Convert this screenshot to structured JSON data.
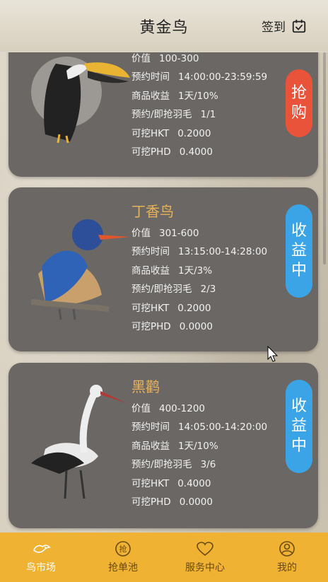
{
  "header": {
    "title": "黄金鸟",
    "checkin_label": "签到",
    "checkin_icon": "calendar-check-icon"
  },
  "cards": [
    {
      "name": "",
      "bird_icon": "toucan-icon",
      "rows": [
        {
          "k": "价值",
          "v": "100-300"
        },
        {
          "k": "预约时间",
          "v": "14:00:00-23:59:59"
        },
        {
          "k": "商品收益",
          "v": "1天/10%"
        },
        {
          "k": "预约/即抢羽毛",
          "v": "1/1"
        },
        {
          "k": "可挖HKT",
          "v": "0.2000"
        },
        {
          "k": "可挖PHD",
          "v": "0.4000"
        }
      ],
      "badge": {
        "label": [
          "抢",
          "购"
        ],
        "color": "#e8533a"
      }
    },
    {
      "name": "丁香鸟",
      "bird_icon": "kingfisher-icon",
      "rows": [
        {
          "k": "价值",
          "v": "301-600"
        },
        {
          "k": "预约时间",
          "v": "13:15:00-14:28:00"
        },
        {
          "k": "商品收益",
          "v": "1天/3%"
        },
        {
          "k": "预约/即抢羽毛",
          "v": "2/3"
        },
        {
          "k": "可挖HKT",
          "v": "0.2000"
        },
        {
          "k": "可挖PHD",
          "v": "0.0000"
        }
      ],
      "badge": {
        "label": [
          "收",
          "益",
          "中"
        ],
        "color": "#3aa4e6"
      }
    },
    {
      "name": "黑鹳",
      "bird_icon": "stork-icon",
      "rows": [
        {
          "k": "价值",
          "v": "400-1200"
        },
        {
          "k": "预约时间",
          "v": "14:05:00-14:20:00"
        },
        {
          "k": "商品收益",
          "v": "1天/10%"
        },
        {
          "k": "预约/即抢羽毛",
          "v": "3/6"
        },
        {
          "k": "可挖HKT",
          "v": "0.4000"
        },
        {
          "k": "可挖PHD",
          "v": "0.0000"
        }
      ],
      "badge": {
        "label": [
          "收",
          "益",
          "中"
        ],
        "color": "#3aa4e6"
      }
    }
  ],
  "tabbar": {
    "tabs": [
      {
        "label": "鸟市场",
        "icon": "bird-icon",
        "active": true
      },
      {
        "label": "抢单池",
        "icon": "grab-icon",
        "active": false
      },
      {
        "label": "服务中心",
        "icon": "heart-icon",
        "active": false
      },
      {
        "label": "我的",
        "icon": "user-icon",
        "active": false
      }
    ]
  },
  "colors": {
    "tabbar": "#f0b233",
    "card": "#6a6764",
    "bird_name": "#e8b25a",
    "badge_blue": "#3aa4e6",
    "badge_red": "#e8533a"
  }
}
